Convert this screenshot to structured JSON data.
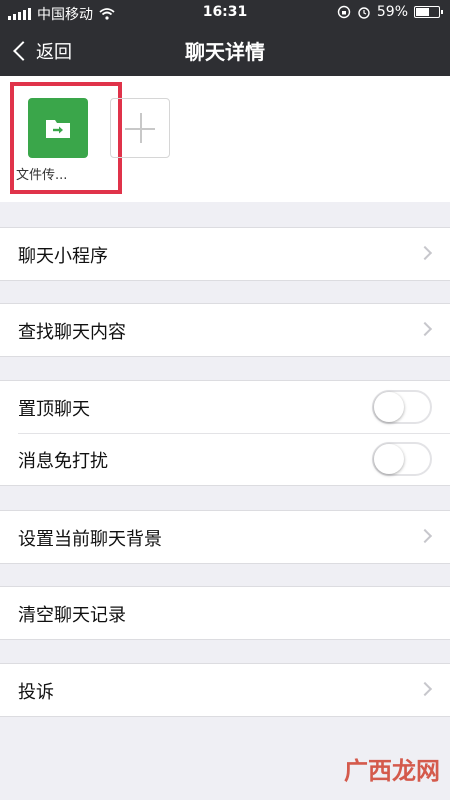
{
  "status_bar": {
    "carrier": "中国移动",
    "time": "16:31",
    "battery_text": "59%",
    "battery_level": 0.59
  },
  "nav": {
    "back_label": "返回",
    "title": "聊天详情"
  },
  "members": {
    "items": [
      {
        "name": "文件传..."
      }
    ]
  },
  "rows": {
    "mini_programs": "聊天小程序",
    "search_chat": "查找聊天内容",
    "pin_chat": "置顶聊天",
    "mute": "消息免打扰",
    "set_background": "设置当前聊天背景",
    "clear_history": "清空聊天记录",
    "report": "投诉"
  },
  "toggles": {
    "pin_chat_on": false,
    "mute_on": false
  },
  "watermark": {
    "text": "广西龙网"
  },
  "colors": {
    "topbar": "#2e2f33",
    "file_transfer_icon": "#3aa64a",
    "highlight_box": "#e0334a",
    "background": "#efeff4"
  }
}
